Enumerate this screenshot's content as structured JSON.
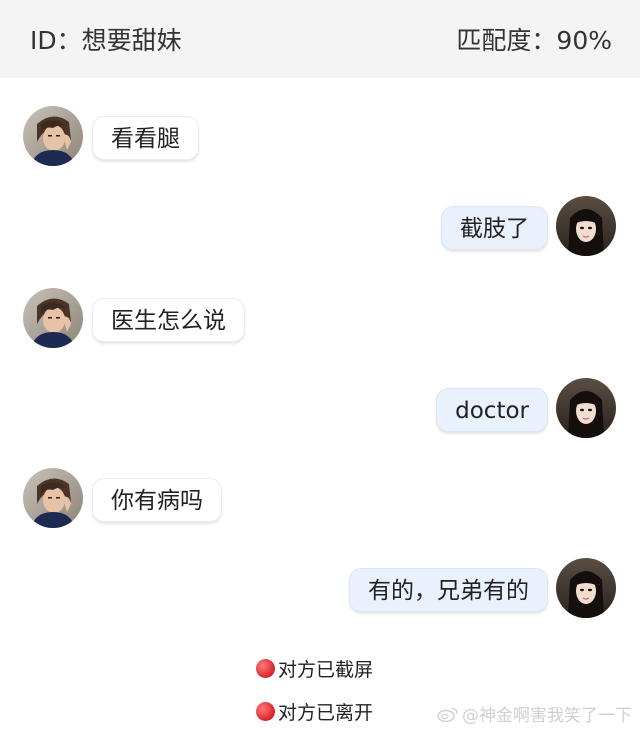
{
  "header": {
    "id_text": "ID：想要甜妹",
    "match_text": "匹配度：90%"
  },
  "messages": [
    {
      "side": "left",
      "text": "看看腿"
    },
    {
      "side": "right",
      "text": "截肢了"
    },
    {
      "side": "left",
      "text": "医生怎么说"
    },
    {
      "side": "right",
      "text": "doctor"
    },
    {
      "side": "left",
      "text": "你有病吗"
    },
    {
      "side": "right",
      "text": "有的，兄弟有的"
    }
  ],
  "system_notices": [
    {
      "icon": "red-dot-icon",
      "text": "对方已截屏"
    },
    {
      "icon": "red-dot-icon",
      "text": "对方已离开"
    }
  ],
  "watermark": {
    "icon": "weibo-icon",
    "text": "@神金啊害我笑了一下"
  },
  "colors": {
    "header_bg": "#f4f4f4",
    "left_bubble": "#ffffff",
    "right_bubble": "#e8f1fc",
    "notice_dot": "#d8232a"
  }
}
